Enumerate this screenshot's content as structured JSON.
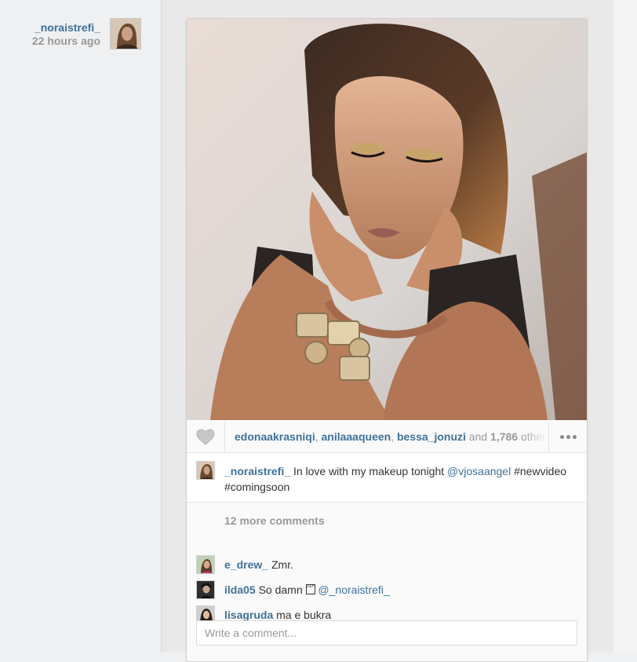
{
  "post": {
    "username": "_noraistrefi_",
    "time_ago": "22 hours ago"
  },
  "likes": {
    "likers": [
      "edonaakrasniqi",
      "anilaaaqueen",
      "bessa_jonuzi"
    ],
    "and_text": "and",
    "count": "1,786",
    "others_text": "others"
  },
  "caption": {
    "username": "_noraistrefi_",
    "text_before": "In love with my makeup tonight",
    "mention": "@vjosaangel",
    "text_after": "#newvideo #comingsoon"
  },
  "comments": {
    "more_label": "12 more comments",
    "items": [
      {
        "username": "e_drew_",
        "text": "Zmr."
      },
      {
        "username": "ilda05",
        "text": "So damn",
        "tofu": "01F 31E",
        "mention": "@_noraistrefi_"
      },
      {
        "username": "lisagruda",
        "text": "ma e bukra"
      }
    ],
    "input_placeholder": "Write a comment..."
  },
  "icons": [
    "heart-icon",
    "more-options-icon"
  ],
  "colors": {
    "link": "#3f729b",
    "muted": "#999999"
  }
}
